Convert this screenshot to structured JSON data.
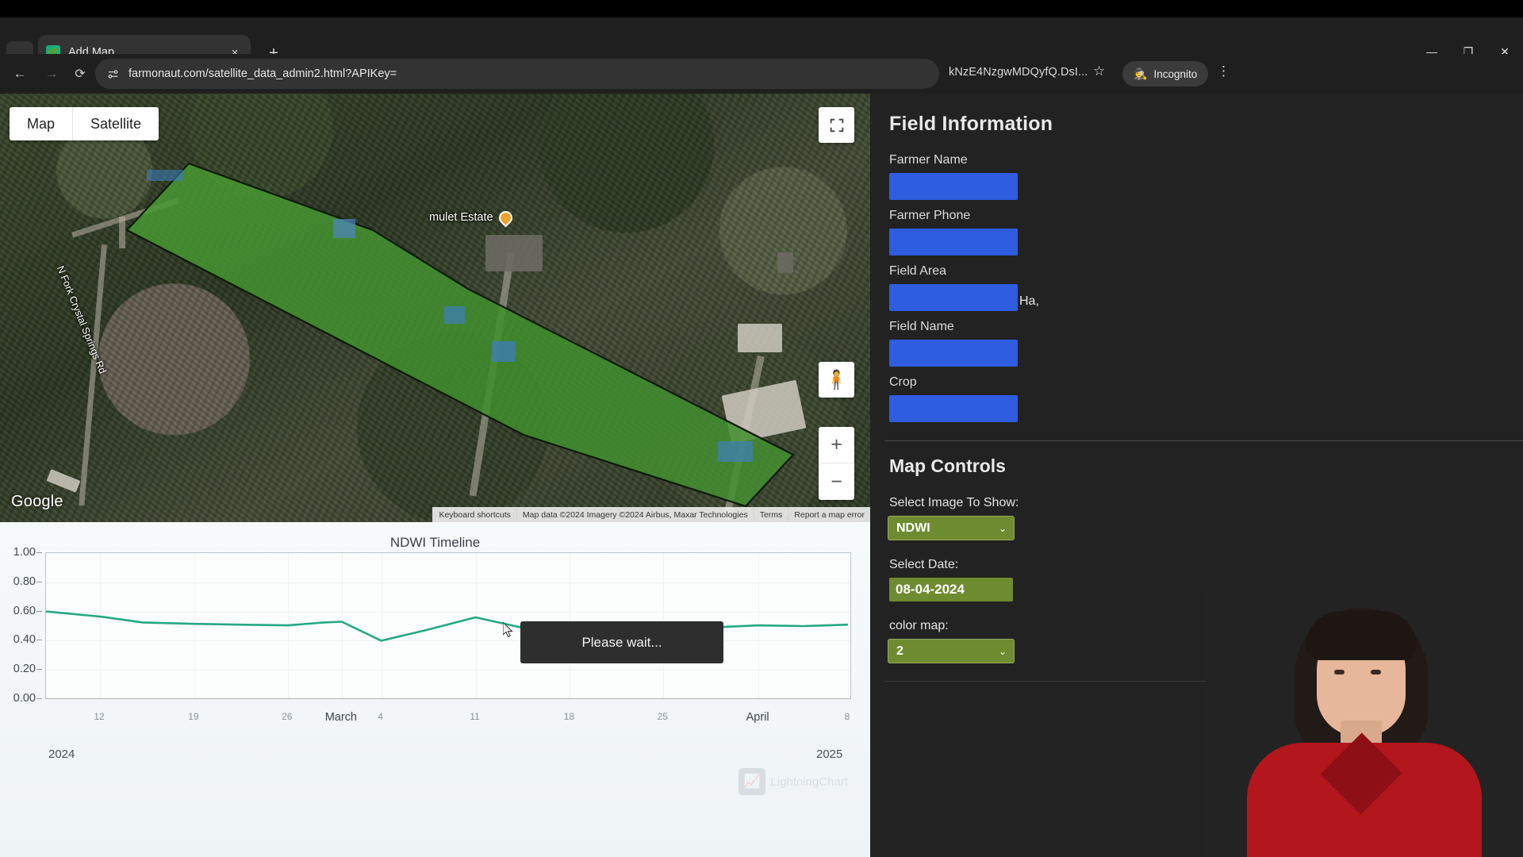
{
  "browser": {
    "tab": {
      "title": "Add Map",
      "favicon_icon": "farmonaut-leaf-icon",
      "close_icon": "×"
    },
    "tab_search_icon": "chevron-down-icon",
    "new_tab_icon": "+",
    "window": {
      "minimize": "—",
      "maximize": "❐",
      "close": "✕"
    },
    "nav": {
      "back_icon": "←",
      "forward_icon": "→",
      "reload_icon": "⟳"
    },
    "omnibox": {
      "site_settings_icon": "tune-icon",
      "url": "farmonaut.com/satellite_data_admin2.html?APIKey=",
      "url_tail": "kNzE4NzgwMDQyfQ.DsI...",
      "bookmark_icon": "☆"
    },
    "incognito": {
      "label": "Incognito",
      "icon": "incognito-hat-icon"
    },
    "menu_icon": "⋮"
  },
  "map": {
    "type_buttons": [
      "Map",
      "Satellite"
    ],
    "fullscreen_icon": "fullscreen-icon",
    "pegman_icon": "street-view-pegman-icon",
    "zoom_in": "+",
    "zoom_out": "−",
    "watermark": "Google",
    "place_label": "mulet Estate",
    "road_label": "N Fork Crystal Springs Rd",
    "attribution": [
      "Keyboard shortcuts",
      "Map data ©2024 Imagery ©2024 Airbus, Maxar Technologies",
      "Terms",
      "Report a map error"
    ]
  },
  "chart_data": {
    "type": "line",
    "title": "NDWI Timeline",
    "xlabel": "",
    "ylabel": "",
    "ylim": [
      0.0,
      1.0
    ],
    "yticks": [
      "1.00",
      "0.80",
      "0.60",
      "0.40",
      "0.20",
      "0.00"
    ],
    "grid": true,
    "legend_position": "none",
    "series_color": "#25a884",
    "xticks": [
      {
        "label": "12",
        "pos": 0.067,
        "major": false
      },
      {
        "label": "19",
        "pos": 0.184,
        "major": false
      },
      {
        "label": "26",
        "pos": 0.3,
        "major": false
      },
      {
        "label": "March",
        "pos": 0.367,
        "major": true
      },
      {
        "label": "4",
        "pos": 0.416,
        "major": false
      },
      {
        "label": "11",
        "pos": 0.533,
        "major": false
      },
      {
        "label": "18",
        "pos": 0.65,
        "major": false
      },
      {
        "label": "25",
        "pos": 0.766,
        "major": false
      },
      {
        "label": "April",
        "pos": 0.884,
        "major": true
      },
      {
        "label": "8",
        "pos": 0.995,
        "major": false
      }
    ],
    "year_start": "2024",
    "year_end": "2025",
    "x": [
      0.0,
      0.067,
      0.12,
      0.184,
      0.24,
      0.3,
      0.345,
      0.367,
      0.416,
      0.47,
      0.533,
      0.59,
      0.65,
      0.71,
      0.766,
      0.825,
      0.884,
      0.94,
      0.995
    ],
    "values": [
      0.6,
      0.565,
      0.525,
      0.515,
      0.51,
      0.505,
      0.525,
      0.53,
      0.4,
      0.47,
      0.56,
      0.49,
      0.435,
      0.44,
      0.47,
      0.49,
      0.505,
      0.5,
      0.51
    ],
    "watermark": "LightningChart"
  },
  "toast": {
    "message": "Please wait..."
  },
  "sidebar": {
    "field_information": {
      "heading": "Field Information",
      "fields": [
        {
          "label": "Farmer Name",
          "value": "",
          "suffix": ""
        },
        {
          "label": "Farmer Phone",
          "value": "",
          "suffix": ""
        },
        {
          "label": "Field Area",
          "value": "",
          "suffix": "Ha,"
        },
        {
          "label": "Field Name",
          "value": "",
          "suffix": ""
        },
        {
          "label": "Crop",
          "value": "",
          "suffix": ""
        }
      ]
    },
    "map_controls": {
      "heading": "Map Controls",
      "image_label": "Select Image To Show:",
      "image_value": "NDWI",
      "date_label": "Select Date:",
      "date_value": "08-04-2024",
      "colormap_label": "color map:",
      "colormap_value": "2",
      "chevron_icon": "chevron-down-icon"
    }
  },
  "colors": {
    "accent_green": "#6f8b30",
    "input_blue": "#2f5de0",
    "sidebar_bg": "#222222",
    "chart_line": "#25a884"
  }
}
